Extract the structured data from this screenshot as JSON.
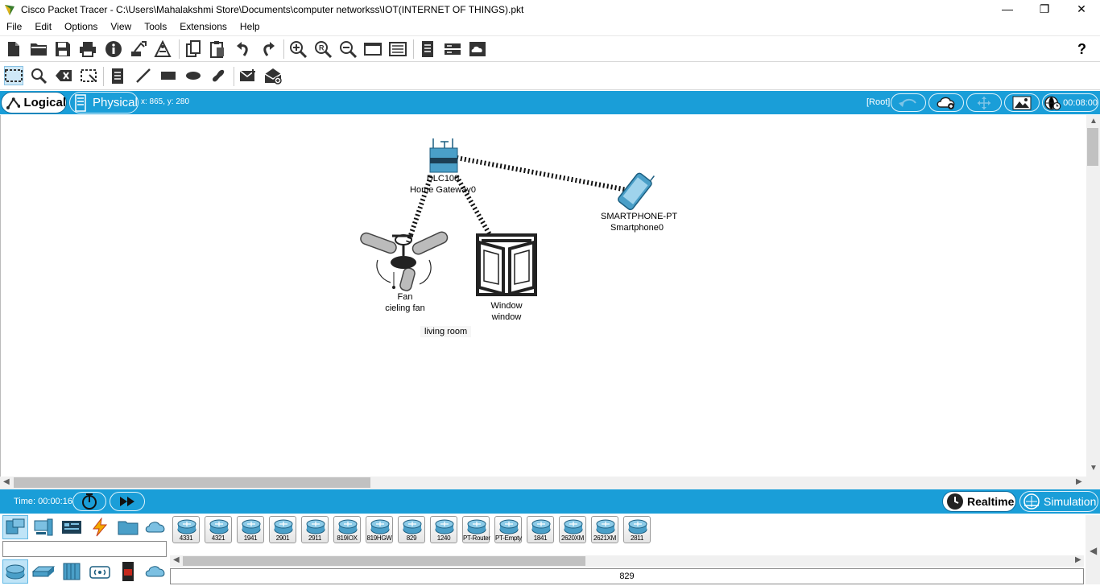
{
  "window": {
    "title": "Cisco Packet Tracer - C:\\Users\\Mahalakshmi Store\\Documents\\computer networkss\\IOT(INTERNET OF THINGS).pkt",
    "minimize": "—",
    "maximize": "❐",
    "close": "✕"
  },
  "menu": [
    "File",
    "Edit",
    "Options",
    "View",
    "Tools",
    "Extensions",
    "Help"
  ],
  "toolbar_main": {
    "icons": [
      "new-icon",
      "open-icon",
      "save-icon",
      "print-icon",
      "info-icon",
      "network-wizard-icon",
      "activity-wizard-icon",
      "copy-icon",
      "paste-icon",
      "undo-icon",
      "redo-icon",
      "zoom-in-icon",
      "zoom-reset-icon",
      "zoom-out-icon",
      "drawing-palette-icon",
      "custom-device-dialog-icon",
      "viewport-icon",
      "ip-config-icon",
      "cloud-icon"
    ],
    "help": "?"
  },
  "toolbar_tools": {
    "icons": [
      "select-icon",
      "inspect-icon",
      "delete-icon",
      "resize-icon",
      "note-icon",
      "line-icon",
      "rectangle-icon",
      "ellipse-icon",
      "freeform-icon",
      "add-simple-pdu-icon",
      "add-complex-pdu-icon"
    ]
  },
  "workspace_bar": {
    "logical_tab": "Logical",
    "physical_tab": "Physical",
    "coordinates": "x: 865, y: 280",
    "root": "[Root]",
    "clock": "00:08:00"
  },
  "canvas": {
    "devices": [
      {
        "model": "DLC100",
        "name": "Home Gateway0"
      },
      {
        "model": "SMARTPHONE-PT",
        "name": "Smartphone0"
      },
      {
        "model": "Fan",
        "name": "cieling fan"
      },
      {
        "model": "Window",
        "name": "window"
      }
    ],
    "note": "living room"
  },
  "sim_bar": {
    "time": "Time: 00:00:16",
    "realtime": "Realtime",
    "simulation": "Simulation"
  },
  "device_panel": {
    "categories_row1": [
      "network-devices-icon",
      "end-devices-icon",
      "components-icon",
      "connections-icon",
      "miscellaneous-icon",
      "multiuser-icon"
    ],
    "categories_row2": [
      "routers-icon",
      "switches-icon",
      "hubs-icon",
      "wireless-icon",
      "security-icon",
      "wan-emulation-icon"
    ],
    "search_value": "",
    "models": [
      "4331",
      "4321",
      "1941",
      "2901",
      "2911",
      "819IOX",
      "819HGW",
      "829",
      "1240",
      "PT-Router",
      "PT-Empty",
      "1841",
      "2620XM",
      "2621XM",
      "2811"
    ],
    "selected_model": "829"
  }
}
